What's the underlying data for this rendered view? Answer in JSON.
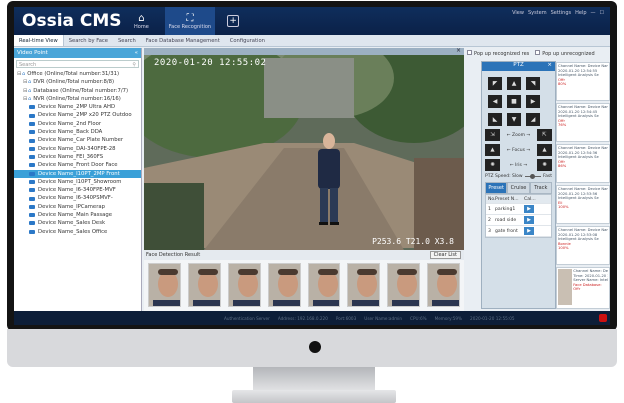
{
  "app": {
    "title": "Ossia CMS",
    "top_right": [
      "View",
      "System",
      "Settings",
      "Help",
      "—",
      "☐"
    ]
  },
  "nav": [
    {
      "label": "Home",
      "icon": "home-icon"
    },
    {
      "label": "Face Recognition",
      "icon": "face-recognition-icon"
    },
    {
      "label": "",
      "icon": "add-icon"
    }
  ],
  "tabs": [
    "Real-time View",
    "Search by Face",
    "Search",
    "Face Database Management",
    "Configuration"
  ],
  "left_panel": {
    "title": "Video Point",
    "search_placeholder": "Search",
    "tree": [
      {
        "label": "Office (Online/Total number:31/31)",
        "level": 0,
        "type": "group"
      },
      {
        "label": "DVR (Online/Total number:8/8)",
        "level": 1,
        "type": "group"
      },
      {
        "label": "Database (Online/Total number:7/7)",
        "level": 1,
        "type": "group"
      },
      {
        "label": "NVR (Online/Total number:16/16)",
        "level": 1,
        "type": "group"
      },
      {
        "label": "Device Name_2MP Ultra AHD",
        "level": 2,
        "type": "device"
      },
      {
        "label": "Device Name_2MP x20 PTZ Outdoo",
        "level": 2,
        "type": "device"
      },
      {
        "label": "Device Name_2nd Floor",
        "level": 2,
        "type": "device"
      },
      {
        "label": "Device Name_Back DDA",
        "level": 2,
        "type": "device"
      },
      {
        "label": "Device Name_Car Plate Number",
        "level": 2,
        "type": "device"
      },
      {
        "label": "Device Name_DAI-340FPE-28",
        "level": 2,
        "type": "device"
      },
      {
        "label": "Device Name_FEI_360FS",
        "level": 2,
        "type": "device"
      },
      {
        "label": "Device Name_Front Door Face",
        "level": 2,
        "type": "device"
      },
      {
        "label": "Device Name_I10PT_2MP Front",
        "level": 2,
        "type": "device",
        "selected": true
      },
      {
        "label": "Device Name_I10PT_Showroom",
        "level": 2,
        "type": "device"
      },
      {
        "label": "Device Name_I6-340FPE-MVF",
        "level": 2,
        "type": "device"
      },
      {
        "label": "Device Name_I6-340PSMVF-",
        "level": 2,
        "type": "device"
      },
      {
        "label": "Device Name_IPCamerap",
        "level": 2,
        "type": "device"
      },
      {
        "label": "Device Name_Main Passage",
        "level": 2,
        "type": "device"
      },
      {
        "label": "Device Name_Sales Desk",
        "level": 2,
        "type": "device"
      },
      {
        "label": "Device Name_Sales Office",
        "level": 2,
        "type": "device"
      }
    ]
  },
  "video": {
    "timestamp": "2020-01-20 12:55:02",
    "ptz_overlay": "P253.6 T21.0 X3.8"
  },
  "face_detection": {
    "title": "Face Detection Result",
    "clear_label": "Clear List",
    "count": 8
  },
  "right_panel": {
    "popup_recognized": "Pop up recognized res",
    "popup_unrecognized": "Pop up unrecognized"
  },
  "ptz": {
    "title": "PTZ",
    "close": "×",
    "zoom_label": "Zoom",
    "focus_label": "Focus",
    "iris_label": "Iris",
    "speed_label": "PTZ Speed: Slow",
    "speed_fast": "Fast",
    "speed_level": 0.35,
    "tabs": [
      "Preset",
      "Cruise",
      "Track"
    ],
    "table_headers": [
      "No.",
      "Preset N...",
      "Cal..."
    ],
    "presets": [
      {
        "no": "1",
        "name": "parking1"
      },
      {
        "no": "2",
        "name": "road side"
      },
      {
        "no": "3",
        "name": "gate front"
      }
    ]
  },
  "feed": [
    {
      "line1": "Channel Name: Device Name_Main F",
      "line2": "2020-01-20 12:54:55",
      "line3": "Intelligent Analysis Se",
      "line4": "Offr",
      "line5": "80%"
    },
    {
      "line1": "Channel Name: Device Name_Main F",
      "line2": "2020-01-20 12:54:45",
      "line3": "Intelligent Analysis Se",
      "line4": "Offr",
      "line5": "76%"
    },
    {
      "line1": "Channel Name: Device Name_Main F",
      "line2": "2020-01-20 12:54:36",
      "line3": "Intelligent Analysis Se",
      "line4": "Offr",
      "line5": "86%"
    },
    {
      "line1": "Channel Name: Device Name_Sales I",
      "line2": "2020-01-20 12:53:56",
      "line3": "Intelligent Analysis Se",
      "line4": "Eli",
      "line5": "100%"
    },
    {
      "line1": "Channel Name: Device Name_Exit Fa",
      "line2": "2020-01-20 12:53:08",
      "line3": "Intelligent Analysis Se",
      "line4": "Bonnie",
      "line5": "100%"
    },
    {
      "line1": "Channel Name: Device Name_Main F",
      "line2": "Time: 2020-01-20 12:49:07",
      "line3": "Server Name: Intelligent Analysis Se",
      "line4": "Face Database:",
      "line5": "Offr",
      "big": true
    },
    {
      "line1": "Channel Name: Device Name_Main F",
      "line2": "",
      "line3": "",
      "line4": "",
      "line5": ""
    }
  ],
  "status": [
    "Authentication Server",
    "Address: 192.168.0.220",
    "Port:6003",
    "User Name:admin",
    "CPU:6%",
    "Memory:59%",
    "2020-01-20 12:55:05"
  ]
}
